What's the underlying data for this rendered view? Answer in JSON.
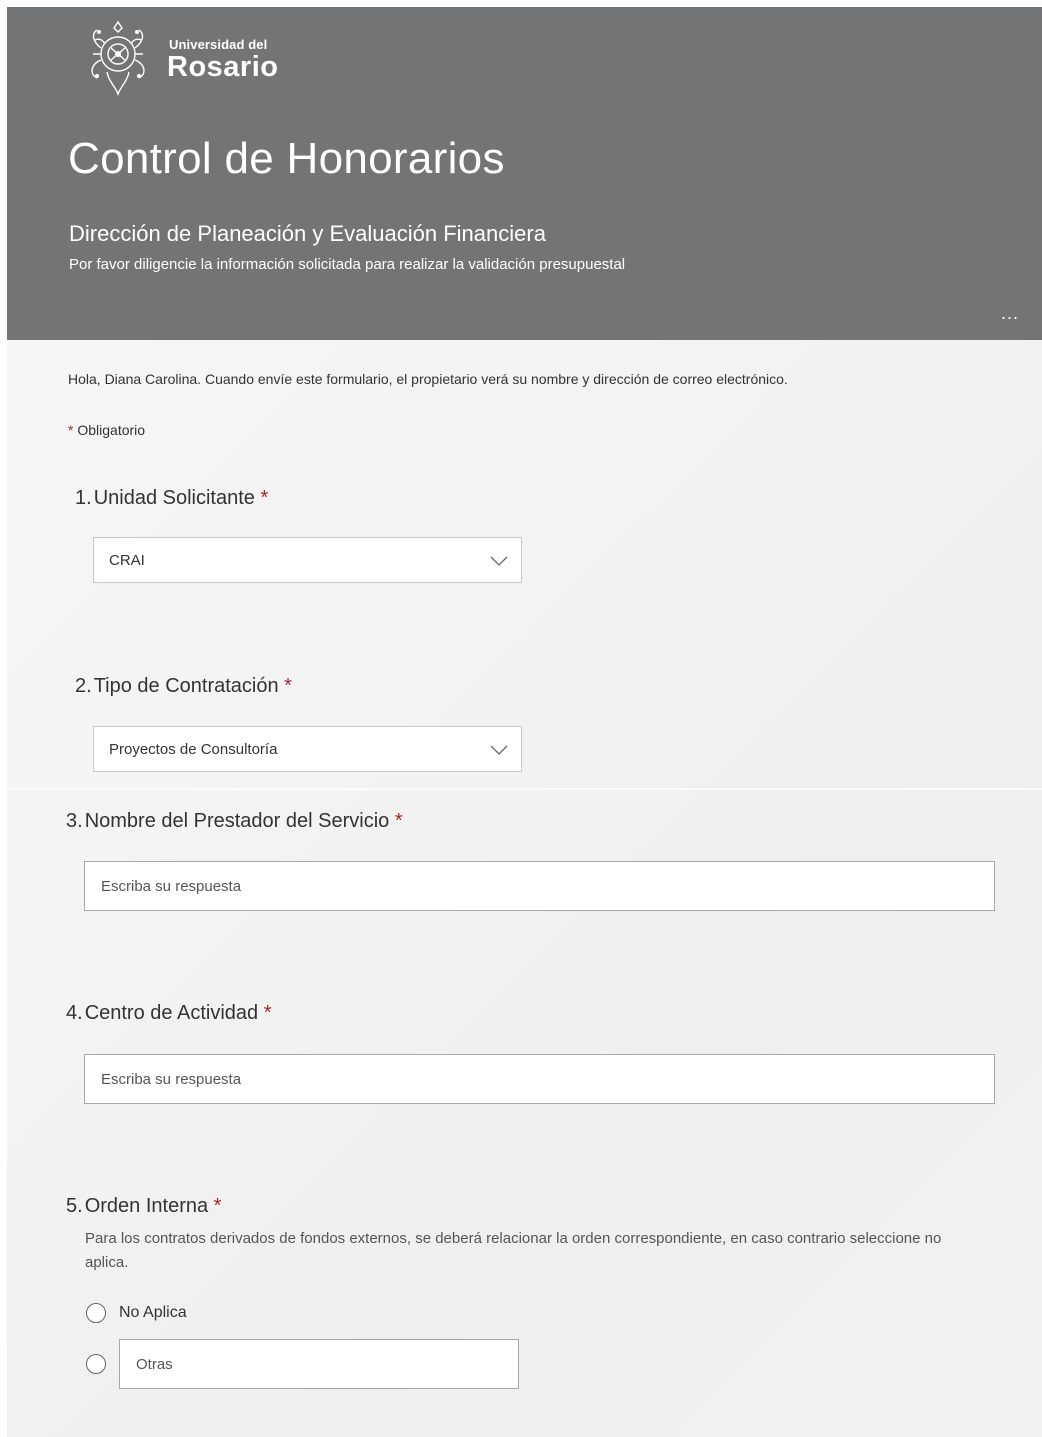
{
  "header": {
    "logo_small": "Universidad del",
    "logo_big": "Rosario",
    "title": "Control de Honorarios",
    "subtitle": "Dirección de Planeación y Evaluación Financiera",
    "description": "Por favor diligencie la información solicitada para realizar la validación presupuestal",
    "more_label": "..."
  },
  "intro": {
    "greeting": "Hola, Diana Carolina. Cuando envíe este formulario, el propietario verá su nombre y dirección de correo electrónico.",
    "required_star": "*",
    "required_label": "Obligatorio"
  },
  "questions": [
    {
      "number": "1.",
      "title": "Unidad Solicitante",
      "required": "*",
      "type": "dropdown",
      "value": "CRAI"
    },
    {
      "number": "2.",
      "title": "Tipo de Contratación",
      "required": "*",
      "type": "dropdown",
      "value": "Proyectos de Consultoría"
    },
    {
      "number": "3.",
      "title": "Nombre del Prestador del Servicio",
      "required": "*",
      "type": "text",
      "placeholder": "Escriba su respuesta"
    },
    {
      "number": "4.",
      "title": "Centro de Actividad",
      "required": "*",
      "type": "text",
      "placeholder": "Escriba su respuesta"
    },
    {
      "number": "5.",
      "title": "Orden Interna",
      "required": "*",
      "type": "radio",
      "description": "Para los contratos derivados de fondos externos, se deberá relacionar la orden correspondiente, en caso contrario seleccione no aplica.",
      "options": [
        "No Aplica"
      ],
      "other_placeholder": "Otras"
    }
  ],
  "colors": {
    "header_bg": "#737475",
    "required_star": "#a4262c",
    "form_bg": "#f3f3f3"
  },
  "icons": [
    "university-emblem-icon",
    "chevron-down-icon",
    "more-options-icon",
    "radio-button-icon"
  ]
}
